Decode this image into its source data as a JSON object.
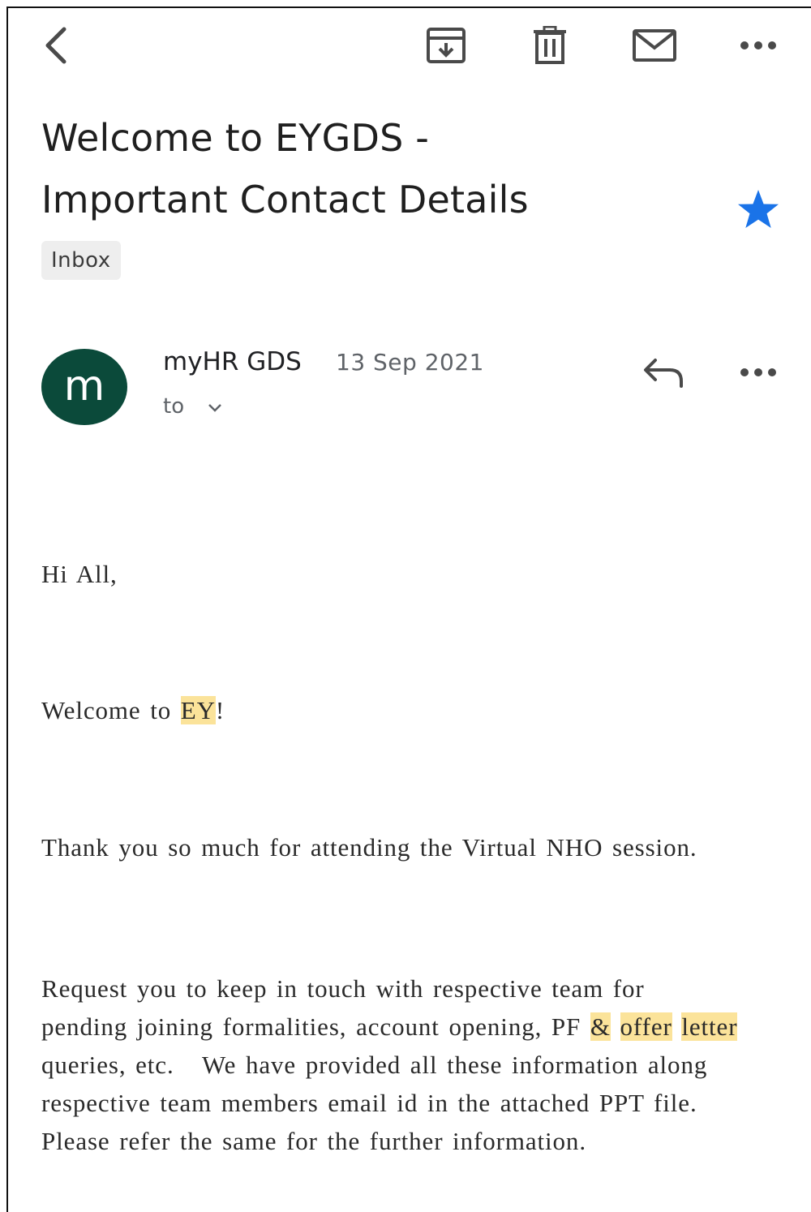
{
  "toolbar": {
    "back_icon": "arrow-back-icon",
    "archive_icon": "archive-icon",
    "delete_icon": "delete-icon",
    "mark_unread_icon": "mail-icon",
    "more_icon": "more-horizontal-icon"
  },
  "email": {
    "subject_line1": "Welcome to EYGDS -",
    "subject_line2": "Important Contact Details",
    "label": "Inbox",
    "starred": true,
    "star_color": "#1a73e8",
    "sender": {
      "avatar_letter": "m",
      "avatar_color": "#0b4a3a",
      "name": "myHR GDS",
      "date": "13 Sep 2021",
      "to_label": "to"
    },
    "body": {
      "greeting": "Hi All,",
      "welcome_before": "Welcome to ",
      "welcome_highlight": "EY",
      "welcome_after": "!",
      "thanks": "Thank you so much for attending the Virtual NHO session.",
      "request_line1": "Request you to keep in touch with respective team for",
      "request_line2_before": "pending joining formalities, account opening, PF ",
      "request_line2_hl1": "&",
      "request_line2_hl2": "offer",
      "request_line2_hl3": "letter",
      "request_line3": "queries, etc.   We have provided all these information along",
      "request_line4": "respective team members email id in the attached PPT file.",
      "request_line5": "Please refer the same for the further information.",
      "highlight_color": "#fbe39a"
    }
  }
}
